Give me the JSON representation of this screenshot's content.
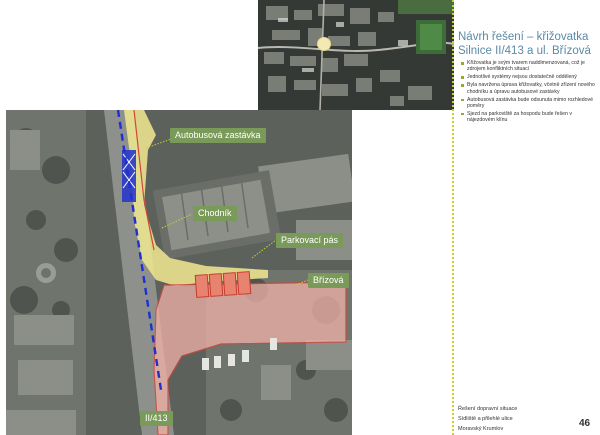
{
  "title_line1": "Návrh řešení –  křižovatka",
  "title_line2": "Silnice II/413 a ul. Břízová",
  "bullets": [
    "Křižovatka je svým tvarem naddimenzovaná, což je zdrojem konfliktních situací",
    "Jednotlivé systémy nejsou dostatečně oddělený",
    "Byla navržena úprava křižovatky, včetně zřízení nového chodníku a úpravu autobusové zastávky",
    "Autobusová zastávka bude odsunuta mimo rozhledové poměry",
    "Sjezd na parkoviště za hospodu bude řešen v nájezdovém klínu"
  ],
  "labels": {
    "bus_stop": "Autobusová zastávka",
    "sidewalk": "Chodník",
    "parking": "Parkovací pás",
    "street": "Břízová",
    "road": "II/413"
  },
  "footer": [
    "Řešení dopravní situace",
    "Sídliště a přilehlé ulice",
    "Moravský Krumlov"
  ],
  "page_number": "46"
}
